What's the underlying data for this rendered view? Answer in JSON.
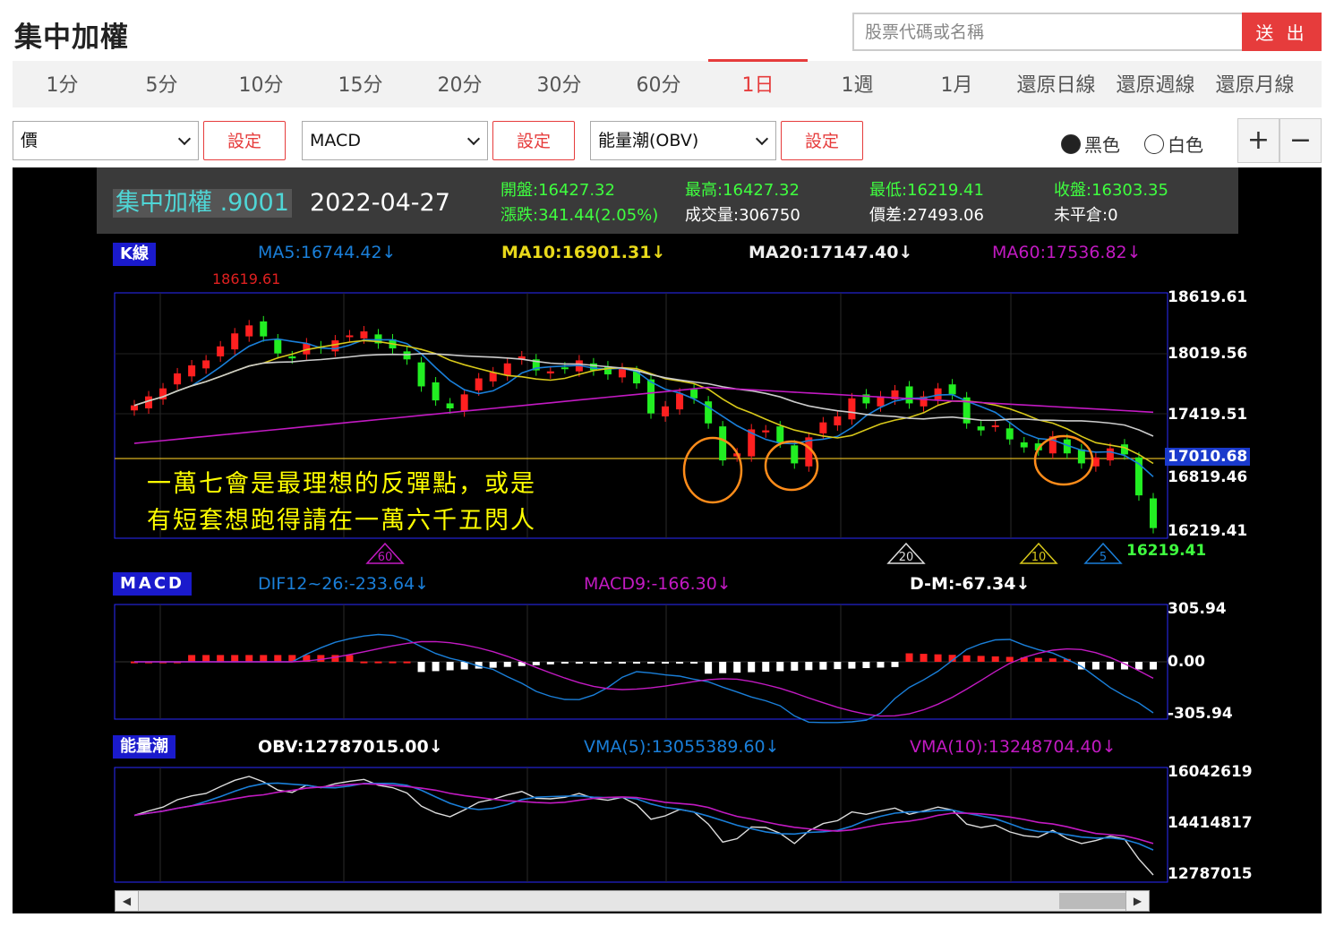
{
  "header": {
    "title": "集中加權",
    "search_placeholder": "股票代碼或名稱",
    "send_label": "送 出"
  },
  "tabs": [
    {
      "label": "1分"
    },
    {
      "label": "5分"
    },
    {
      "label": "10分"
    },
    {
      "label": "15分"
    },
    {
      "label": "20分"
    },
    {
      "label": "30分"
    },
    {
      "label": "60分"
    },
    {
      "label": "1日",
      "active": true
    },
    {
      "label": "1週"
    },
    {
      "label": "1月"
    },
    {
      "label": "還原日線"
    },
    {
      "label": "還原週線"
    },
    {
      "label": "還原月線"
    }
  ],
  "controls": {
    "select1": "價",
    "select2": "MACD",
    "select3": "能量潮(OBV)",
    "set_label": "設定",
    "radio_black": "黑色",
    "radio_white": "白色",
    "zoom_in": "+",
    "zoom_out": "−"
  },
  "info": {
    "name": "集中加權 .9001",
    "date": "2022-04-27",
    "open": "開盤:16427.32",
    "change": "漲跌:341.44(2.05%)",
    "high": "最高:16427.32",
    "volume": "成交量:306750",
    "low": "最低:16219.41",
    "spread": "價差:27493.06",
    "close": "收盤:16303.35",
    "oi": "未平倉:0"
  },
  "kline": {
    "label": "K線",
    "ma5": "MA5:16744.42↓",
    "ma10": "MA10:16901.31↓",
    "ma20": "MA20:17147.40↓",
    "ma60": "MA60:17536.82↓",
    "high_mark": "18619.61",
    "low_mark": "16219.41",
    "axis": [
      "18619.61",
      "18019.56",
      "17419.51",
      "17010.68",
      "16819.46",
      "16219.41"
    ],
    "markers": [
      "60",
      "20",
      "10",
      "5"
    ]
  },
  "annotation": {
    "line1": "一萬七會是最理想的反彈點，或是",
    "line2": "有短套想跑得請在一萬六千五閃人"
  },
  "macd": {
    "label": "MACD",
    "dif": "DIF12~26:-233.64↓",
    "macd9": "MACD9:-166.30↓",
    "dm": "D-M:-67.34↓",
    "axis": [
      "305.94",
      "0.00",
      "-305.94"
    ]
  },
  "obv": {
    "label": "能量潮",
    "obv": "OBV:12787015.00↓",
    "vma5": "VMA(5):13055389.60↓",
    "vma10": "VMA(10):13248704.40↓",
    "axis": [
      "16042619",
      "14414817",
      "12787015"
    ]
  },
  "colors": {
    "up": "#ff2020",
    "down": "#22ee22",
    "ma5": "#1a7fd9",
    "ma10": "#d8c81a",
    "ma20": "#cccccc",
    "ma60": "#c21ac2",
    "accent": "#e63c3c",
    "highlight": "#ff8c1a"
  }
}
